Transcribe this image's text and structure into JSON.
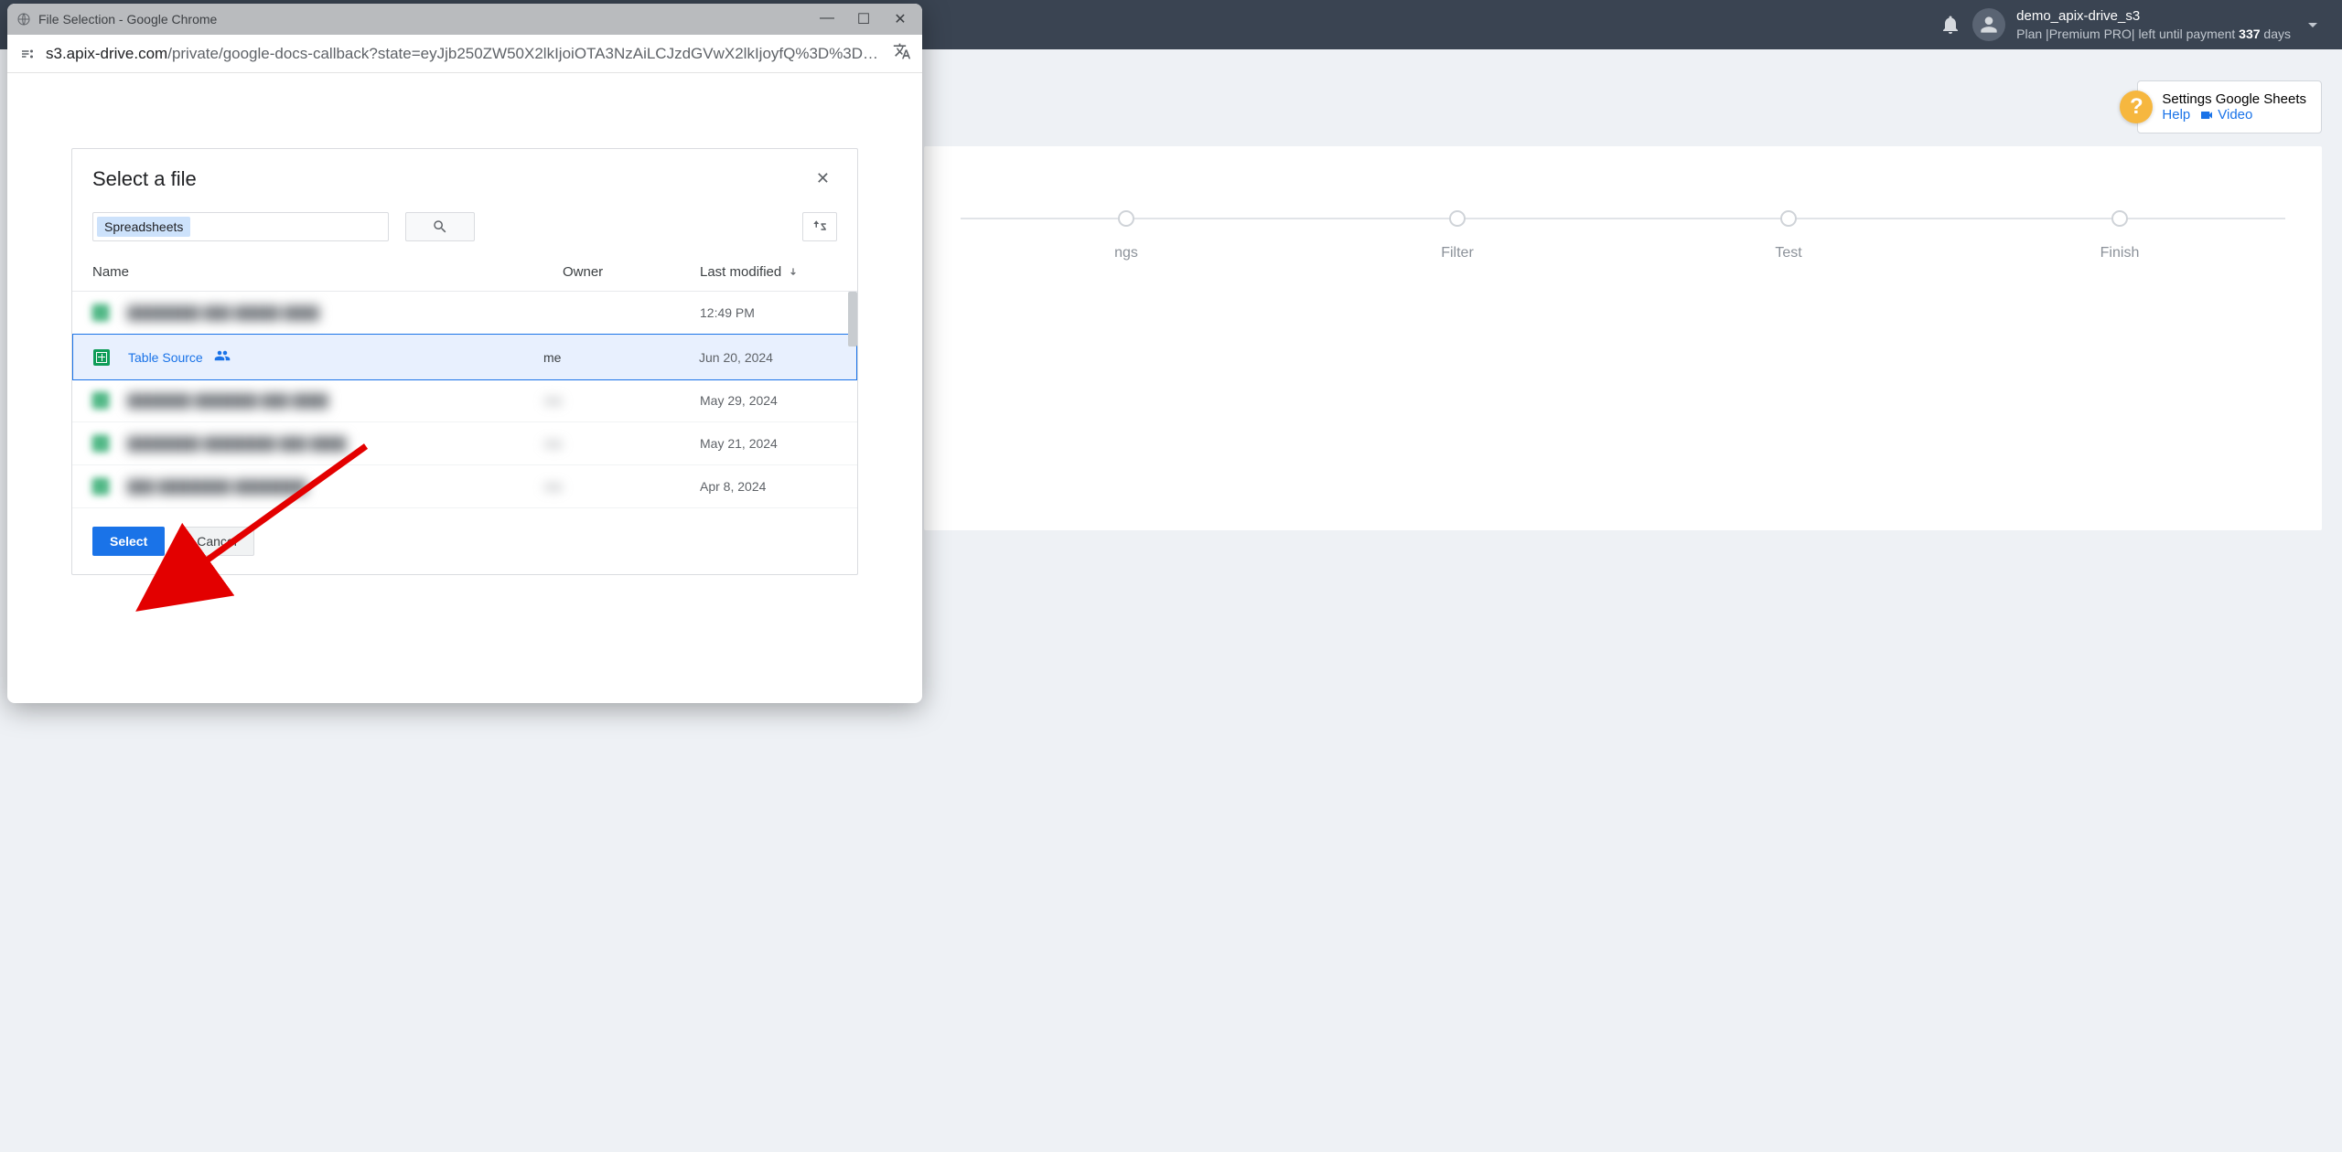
{
  "header": {
    "user_name": "demo_apix-drive_s3",
    "plan_prefix": "Plan |Premium PRO| left until payment ",
    "plan_days": "337",
    "plan_suffix": " days"
  },
  "settings_card": {
    "title": "Settings Google Sheets",
    "help_label": "Help",
    "video_label": "Video"
  },
  "steps": {
    "items": [
      {
        "label": "ngs"
      },
      {
        "label": "Filter"
      },
      {
        "label": "Test"
      },
      {
        "label": "Finish"
      }
    ]
  },
  "popup": {
    "window_title": "File Selection - Google Chrome",
    "url_domain": "s3.apix-drive.com",
    "url_path": "/private/google-docs-callback?state=eyJjb250ZW50X2lkIjoiOTA3NzAiLCJzdGVwX2lkIjoyfQ%3D%3D…"
  },
  "picker": {
    "title": "Select a file",
    "search_chip": "Spreadsheets",
    "columns": {
      "name": "Name",
      "owner": "Owner",
      "modified": "Last modified"
    },
    "rows": [
      {
        "name": "████████ ███ █████ ████",
        "owner": "",
        "modified": "12:49 PM",
        "blurred": true
      },
      {
        "name": "Table Source",
        "owner": "me",
        "modified": "Jun 20, 2024",
        "selected": true,
        "shared": true
      },
      {
        "name": "███████ ███████ ███ ████",
        "owner": "me",
        "modified": "May 29, 2024",
        "blurred": true
      },
      {
        "name": "████████ ████████ ███ ████",
        "owner": "me",
        "modified": "May 21, 2024",
        "blurred": true
      },
      {
        "name": "███ ████████ ████████",
        "owner": "me",
        "modified": "Apr 8, 2024",
        "blurred": true
      }
    ],
    "select_label": "Select",
    "cancel_label": "Cancel"
  }
}
